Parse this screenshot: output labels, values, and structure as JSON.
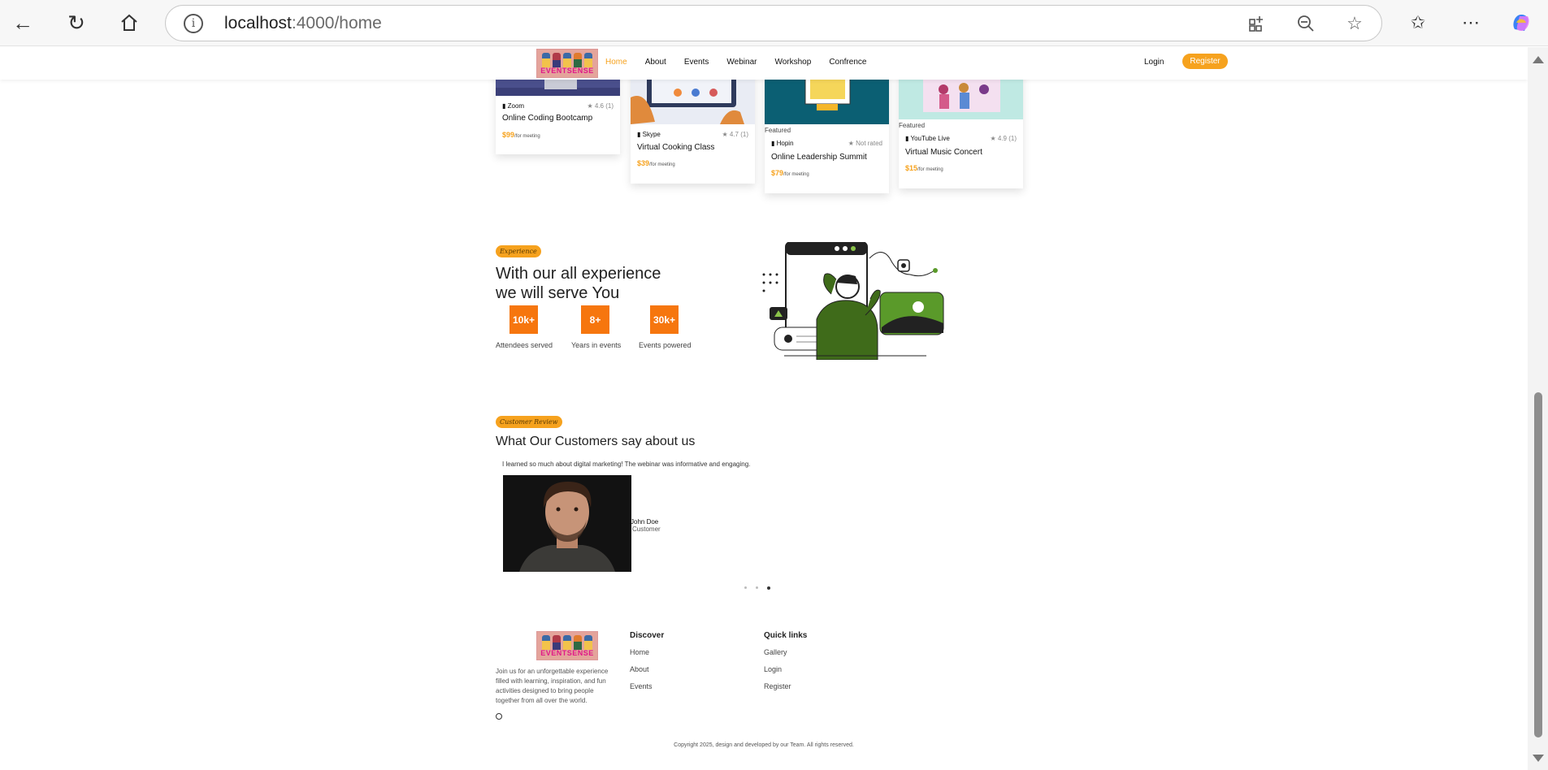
{
  "browser": {
    "url_host": "localhost",
    "url_rest": ":4000/home"
  },
  "nav": {
    "logo_text": "EVENTSENSE",
    "links": [
      "Home",
      "About",
      "Events",
      "Webinar",
      "Workshop",
      "Confrence"
    ],
    "login": "Login",
    "register": "Register"
  },
  "events": [
    {
      "platform": "Zoom",
      "rating": "4.6 (1)",
      "title": "Online Coding Bootcamp",
      "price": "$99",
      "unit": "/for meeting",
      "featured": ""
    },
    {
      "platform": "Skype",
      "rating": "4.7 (1)",
      "title": "Virtual Cooking Class",
      "price": "$39",
      "unit": "/for meeting",
      "featured": ""
    },
    {
      "platform": "Hopin",
      "rating": "Not rated",
      "title": "Online Leadership Summit",
      "price": "$79",
      "unit": "/for meeting",
      "featured": "Featured"
    },
    {
      "platform": "YouTube Live",
      "rating": "4.9 (1)",
      "title": "Virtual Music Concert",
      "price": "$15",
      "unit": "/for meeting",
      "featured": "Featured"
    }
  ],
  "experience": {
    "tag": "Experience",
    "heading_line1": "With our all experience",
    "heading_line2": "we will serve You",
    "stats": [
      {
        "value": "10k+",
        "label": "Attendees served"
      },
      {
        "value": "8+",
        "label": "Years in events"
      },
      {
        "value": "30k+",
        "label": "Events powered"
      }
    ]
  },
  "reviews": {
    "tag": "Customer Review",
    "heading": "What Our Customers say about us",
    "quote": "I learned so much about digital marketing! The webinar was informative and engaging.",
    "name": "John Doe",
    "role": "Customer",
    "active_dot": 3,
    "dot_count": 3
  },
  "footer": {
    "about": "Join us for an unforgettable experience filled with learning, inspiration, and fun activities designed to bring people together from all over the world.",
    "discover_title": "Discover",
    "discover": [
      "Home",
      "About",
      "Events"
    ],
    "quick_title": "Quick links",
    "quick": [
      "Gallery",
      "Login",
      "Register"
    ],
    "copyright": "Copyright 2025, design and developed by our Team. All rights reserved."
  },
  "colors": {
    "accent": "#f6a21e",
    "stat": "#f6760e"
  }
}
